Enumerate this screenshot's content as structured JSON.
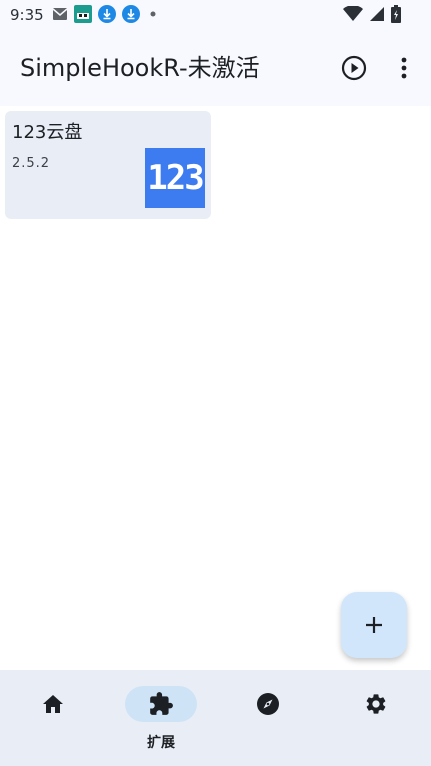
{
  "status_bar": {
    "time": "9:35"
  },
  "app_bar": {
    "title": "SimpleHookR-未激活"
  },
  "extensions": [
    {
      "name": "123云盘",
      "version": "2.5.2",
      "logo_text": "123",
      "logo_color": "#3d7bf0"
    }
  ],
  "bottom_nav": {
    "items": [
      {
        "id": "home",
        "label": ""
      },
      {
        "id": "extensions",
        "label": "扩展",
        "active": true
      },
      {
        "id": "discover",
        "label": ""
      },
      {
        "id": "settings",
        "label": ""
      }
    ]
  },
  "colors": {
    "accent_container": "#cfe3f6",
    "surface": "#e9eef6",
    "fab": "#d2e6fb",
    "icon": "#1c1f24"
  }
}
